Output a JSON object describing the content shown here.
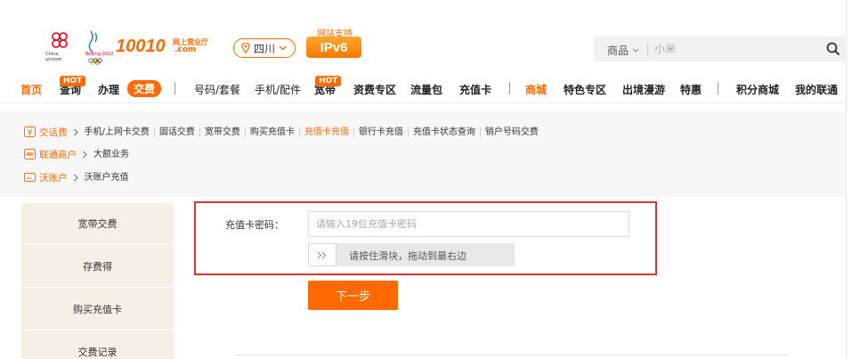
{
  "header": {
    "logo_caption": "10010",
    "logo_sub_a": "网上营业厅",
    "logo_sub_b": ".com",
    "location": "四川",
    "ipv6_caption": "网站支持",
    "ipv6_label": "IPv6",
    "search_category": "商品",
    "search_placeholder": "小米"
  },
  "nav": {
    "hot_label": "HOT",
    "items": [
      {
        "label": "首页"
      },
      {
        "label": "查询"
      },
      {
        "label": "办理"
      },
      {
        "label": "交费"
      },
      {
        "label": "号码/套餐"
      },
      {
        "label": "手机/配件"
      },
      {
        "label": "宽带"
      },
      {
        "label": "资费专区"
      },
      {
        "label": "流量包"
      },
      {
        "label": "充值卡"
      },
      {
        "label": "商城"
      },
      {
        "label": "特色专区"
      },
      {
        "label": "出境漫游"
      },
      {
        "label": "特惠"
      },
      {
        "label": "积分商城"
      },
      {
        "label": "我的联通"
      }
    ]
  },
  "crumbs": {
    "row1": {
      "lead": "交话费",
      "links": [
        "手机/上网卡交费",
        "固话交费",
        "宽带交费",
        "购买充值卡",
        "充值卡充值",
        "银行卡充值",
        "充值卡状态查询",
        "销户号码交费"
      ]
    },
    "row2": {
      "lead": "联通商户",
      "links": [
        "大额业务"
      ]
    },
    "row3": {
      "lead": "沃账户",
      "links": [
        "沃账户充值"
      ]
    }
  },
  "sidebar": {
    "items": [
      "宽带交费",
      "存费得",
      "购买充值卡",
      "交费记录"
    ]
  },
  "form": {
    "label": "充值卡密码：",
    "input_placeholder": "请输入19位充值卡密码",
    "slider_text": "请按住滑块，拖动到最右边",
    "submit_label": "下一步"
  },
  "colors": {
    "accent": "#ff6a00",
    "highlight_border": "#e03232",
    "sidebar_bg": "#f5efe6"
  }
}
